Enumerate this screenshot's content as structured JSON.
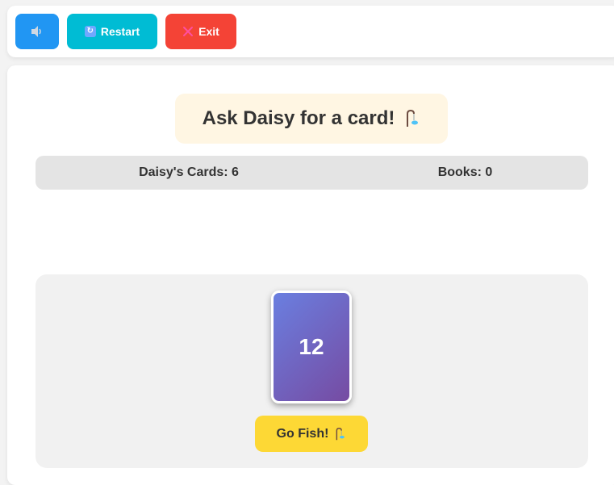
{
  "toolbar": {
    "sound_icon": "speaker-icon",
    "restart_label": "Restart",
    "restart_icon": "refresh-icon",
    "exit_label": "Exit",
    "exit_icon": "close-icon"
  },
  "prompt": {
    "text": "Ask Daisy for a card!",
    "icon": "fishing-pole-icon"
  },
  "stats": {
    "cards_label": "Daisy's Cards: 6",
    "books_label": "Books: 0"
  },
  "hand": {
    "cards": [
      "12"
    ]
  },
  "go_fish": {
    "label": "Go Fish!",
    "icon": "fishing-pole-icon"
  },
  "colors": {
    "sound_button": "#2196f3",
    "restart_button": "#00bcd4",
    "exit_button": "#f44336",
    "go_fish_button": "#fdd835",
    "card_gradient_start": "#6a7fe0",
    "card_gradient_end": "#764ba2"
  }
}
